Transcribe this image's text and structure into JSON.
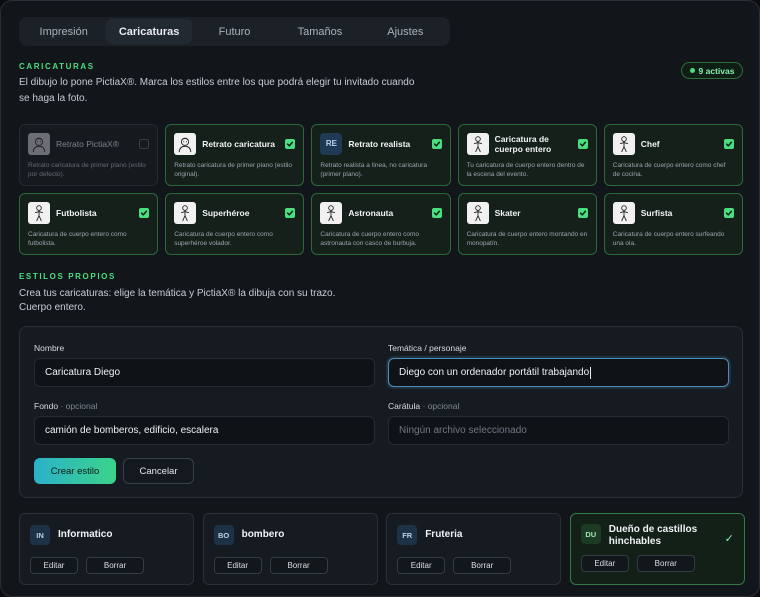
{
  "tabs": [
    "Impresión",
    "Caricaturas",
    "Futuro",
    "Tamaños",
    "Ajustes"
  ],
  "active_tab": "Caricaturas",
  "caricaturas": {
    "title": "CARICATURAS",
    "description": "El dibujo lo pone PictiaX®. Marca los estilos entre los que podrá elegir tu invitado cuando se haga la foto.",
    "badge": "9 activas",
    "cards": [
      {
        "name": "Retrato PictiaX®",
        "desc": "Retrato caricatura de primer plano (estilo por defecto).",
        "checked": false,
        "avatar": "person-portrait-icon"
      },
      {
        "name": "Retrato caricatura",
        "desc": "Retrato caricatura de primer plano (estilo original).",
        "checked": true,
        "avatar": "person-portrait-icon"
      },
      {
        "name": "Retrato realista",
        "desc": "Retrato realista a línea, no caricatura (primer plano).",
        "checked": true,
        "avatar_text": "RE"
      },
      {
        "name": "Caricatura de cuerpo entero",
        "desc": "Tu caricatura de cuerpo entero dentro de la escena del evento.",
        "checked": true,
        "avatar": "full-body-icon"
      },
      {
        "name": "Chef",
        "desc": "Caricatura de cuerpo entero como chef de cocina.",
        "checked": true,
        "avatar": "chef-icon"
      },
      {
        "name": "Futbolista",
        "desc": "Caricatura de cuerpo entero como futbolista.",
        "checked": true,
        "avatar": "footballer-icon"
      },
      {
        "name": "Superhéroe",
        "desc": "Caricatura de cuerpo entero como superhéroe volador.",
        "checked": true,
        "avatar": "superhero-icon"
      },
      {
        "name": "Astronauta",
        "desc": "Caricatura de cuerpo entero como astronauta con casco de burbuja.",
        "checked": true,
        "avatar": "astronaut-icon"
      },
      {
        "name": "Skater",
        "desc": "Caricatura de cuerpo entero montando en monopatín.",
        "checked": true,
        "avatar": "skater-icon"
      },
      {
        "name": "Surfista",
        "desc": "Caricatura de cuerpo entero surfeando una ola.",
        "checked": true,
        "avatar": "surfer-icon"
      }
    ]
  },
  "estilos": {
    "title": "ESTILOS PROPIOS",
    "description": "Crea tus caricaturas: elige la temática y PictiaX® la dibuja con su trazo.",
    "description2": "Cuerpo entero.",
    "form": {
      "nombre_label": "Nombre",
      "nombre_value": "Caricatura Diego",
      "tematica_label": "Temática / personaje",
      "tematica_value": "Diego con un ordenador portátil trabajando",
      "fondo_label": "Fondo",
      "fondo_optional": "· opcional",
      "fondo_value": "camión de bomberos, edificio, escalera",
      "caratula_label": "Carátula",
      "caratula_optional": "· opcional",
      "caratula_value": "Ningún archivo seleccionado",
      "crear_label": "Crear estilo",
      "cancelar_label": "Cancelar"
    },
    "items": [
      {
        "initials": "IN",
        "name": "Informatico",
        "selected": false
      },
      {
        "initials": "BO",
        "name": "bombero",
        "selected": false
      },
      {
        "initials": "FR",
        "name": "Fruteria",
        "selected": false
      },
      {
        "initials": "DU",
        "name": "Dueño de castillos hinchables",
        "selected": true
      }
    ],
    "edit_label": "Editar",
    "delete_label": "Borrar",
    "selected_mark": "✓"
  },
  "colors": {
    "accent": "#4ade80",
    "focus": "#4b8fb8"
  }
}
